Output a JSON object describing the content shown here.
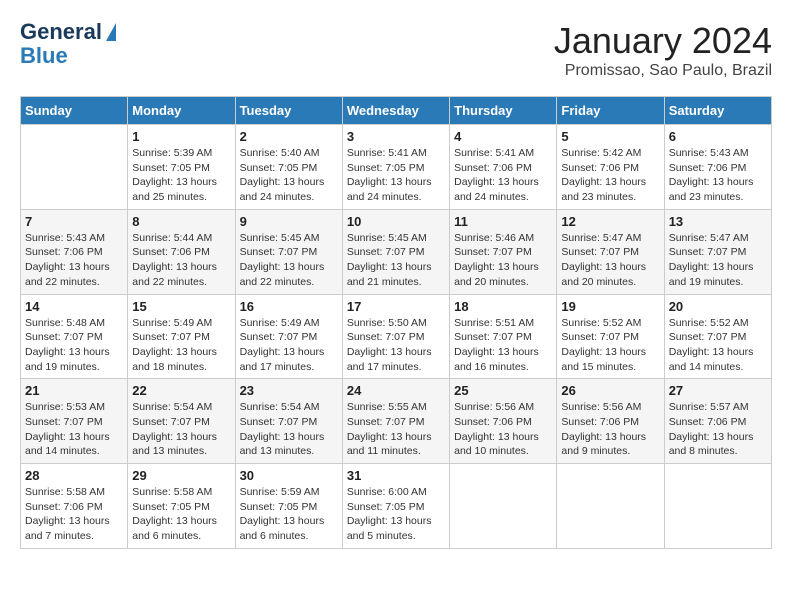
{
  "header": {
    "logo_general": "General",
    "logo_blue": "Blue",
    "title": "January 2024",
    "subtitle": "Promissao, Sao Paulo, Brazil"
  },
  "calendar": {
    "days_of_week": [
      "Sunday",
      "Monday",
      "Tuesday",
      "Wednesday",
      "Thursday",
      "Friday",
      "Saturday"
    ],
    "weeks": [
      [
        {
          "day": "",
          "info": ""
        },
        {
          "day": "1",
          "info": "Sunrise: 5:39 AM\nSunset: 7:05 PM\nDaylight: 13 hours\nand 25 minutes."
        },
        {
          "day": "2",
          "info": "Sunrise: 5:40 AM\nSunset: 7:05 PM\nDaylight: 13 hours\nand 24 minutes."
        },
        {
          "day": "3",
          "info": "Sunrise: 5:41 AM\nSunset: 7:05 PM\nDaylight: 13 hours\nand 24 minutes."
        },
        {
          "day": "4",
          "info": "Sunrise: 5:41 AM\nSunset: 7:06 PM\nDaylight: 13 hours\nand 24 minutes."
        },
        {
          "day": "5",
          "info": "Sunrise: 5:42 AM\nSunset: 7:06 PM\nDaylight: 13 hours\nand 23 minutes."
        },
        {
          "day": "6",
          "info": "Sunrise: 5:43 AM\nSunset: 7:06 PM\nDaylight: 13 hours\nand 23 minutes."
        }
      ],
      [
        {
          "day": "7",
          "info": "Sunrise: 5:43 AM\nSunset: 7:06 PM\nDaylight: 13 hours\nand 22 minutes."
        },
        {
          "day": "8",
          "info": "Sunrise: 5:44 AM\nSunset: 7:06 PM\nDaylight: 13 hours\nand 22 minutes."
        },
        {
          "day": "9",
          "info": "Sunrise: 5:45 AM\nSunset: 7:07 PM\nDaylight: 13 hours\nand 22 minutes."
        },
        {
          "day": "10",
          "info": "Sunrise: 5:45 AM\nSunset: 7:07 PM\nDaylight: 13 hours\nand 21 minutes."
        },
        {
          "day": "11",
          "info": "Sunrise: 5:46 AM\nSunset: 7:07 PM\nDaylight: 13 hours\nand 20 minutes."
        },
        {
          "day": "12",
          "info": "Sunrise: 5:47 AM\nSunset: 7:07 PM\nDaylight: 13 hours\nand 20 minutes."
        },
        {
          "day": "13",
          "info": "Sunrise: 5:47 AM\nSunset: 7:07 PM\nDaylight: 13 hours\nand 19 minutes."
        }
      ],
      [
        {
          "day": "14",
          "info": "Sunrise: 5:48 AM\nSunset: 7:07 PM\nDaylight: 13 hours\nand 19 minutes."
        },
        {
          "day": "15",
          "info": "Sunrise: 5:49 AM\nSunset: 7:07 PM\nDaylight: 13 hours\nand 18 minutes."
        },
        {
          "day": "16",
          "info": "Sunrise: 5:49 AM\nSunset: 7:07 PM\nDaylight: 13 hours\nand 17 minutes."
        },
        {
          "day": "17",
          "info": "Sunrise: 5:50 AM\nSunset: 7:07 PM\nDaylight: 13 hours\nand 17 minutes."
        },
        {
          "day": "18",
          "info": "Sunrise: 5:51 AM\nSunset: 7:07 PM\nDaylight: 13 hours\nand 16 minutes."
        },
        {
          "day": "19",
          "info": "Sunrise: 5:52 AM\nSunset: 7:07 PM\nDaylight: 13 hours\nand 15 minutes."
        },
        {
          "day": "20",
          "info": "Sunrise: 5:52 AM\nSunset: 7:07 PM\nDaylight: 13 hours\nand 14 minutes."
        }
      ],
      [
        {
          "day": "21",
          "info": "Sunrise: 5:53 AM\nSunset: 7:07 PM\nDaylight: 13 hours\nand 14 minutes."
        },
        {
          "day": "22",
          "info": "Sunrise: 5:54 AM\nSunset: 7:07 PM\nDaylight: 13 hours\nand 13 minutes."
        },
        {
          "day": "23",
          "info": "Sunrise: 5:54 AM\nSunset: 7:07 PM\nDaylight: 13 hours\nand 13 minutes."
        },
        {
          "day": "24",
          "info": "Sunrise: 5:55 AM\nSunset: 7:07 PM\nDaylight: 13 hours\nand 11 minutes."
        },
        {
          "day": "25",
          "info": "Sunrise: 5:56 AM\nSunset: 7:06 PM\nDaylight: 13 hours\nand 10 minutes."
        },
        {
          "day": "26",
          "info": "Sunrise: 5:56 AM\nSunset: 7:06 PM\nDaylight: 13 hours\nand 9 minutes."
        },
        {
          "day": "27",
          "info": "Sunrise: 5:57 AM\nSunset: 7:06 PM\nDaylight: 13 hours\nand 8 minutes."
        }
      ],
      [
        {
          "day": "28",
          "info": "Sunrise: 5:58 AM\nSunset: 7:06 PM\nDaylight: 13 hours\nand 7 minutes."
        },
        {
          "day": "29",
          "info": "Sunrise: 5:58 AM\nSunset: 7:05 PM\nDaylight: 13 hours\nand 6 minutes."
        },
        {
          "day": "30",
          "info": "Sunrise: 5:59 AM\nSunset: 7:05 PM\nDaylight: 13 hours\nand 6 minutes."
        },
        {
          "day": "31",
          "info": "Sunrise: 6:00 AM\nSunset: 7:05 PM\nDaylight: 13 hours\nand 5 minutes."
        },
        {
          "day": "",
          "info": ""
        },
        {
          "day": "",
          "info": ""
        },
        {
          "day": "",
          "info": ""
        }
      ]
    ]
  }
}
